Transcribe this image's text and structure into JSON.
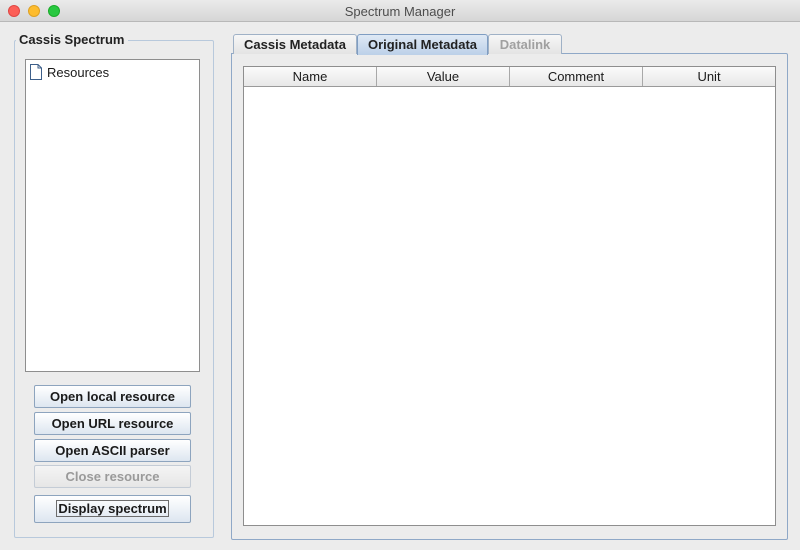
{
  "window": {
    "title": "Spectrum Manager"
  },
  "left_panel": {
    "title": "Cassis Spectrum",
    "tree": {
      "root_label": "Resources"
    },
    "buttons": {
      "open_local": "Open local resource",
      "open_url": "Open URL resource",
      "open_ascii": "Open ASCII parser",
      "close_resource": "Close resource",
      "display_spectrum": "Display spectrum"
    }
  },
  "tabs": [
    {
      "label": "Cassis Metadata",
      "selected": false,
      "enabled": true
    },
    {
      "label": "Original Metadata",
      "selected": true,
      "enabled": true
    },
    {
      "label": "Datalink",
      "selected": false,
      "enabled": false
    }
  ],
  "metadata_table": {
    "columns": [
      "Name",
      "Value",
      "Comment",
      "Unit"
    ],
    "rows": []
  },
  "icons": {
    "tree_root": "document-icon"
  }
}
